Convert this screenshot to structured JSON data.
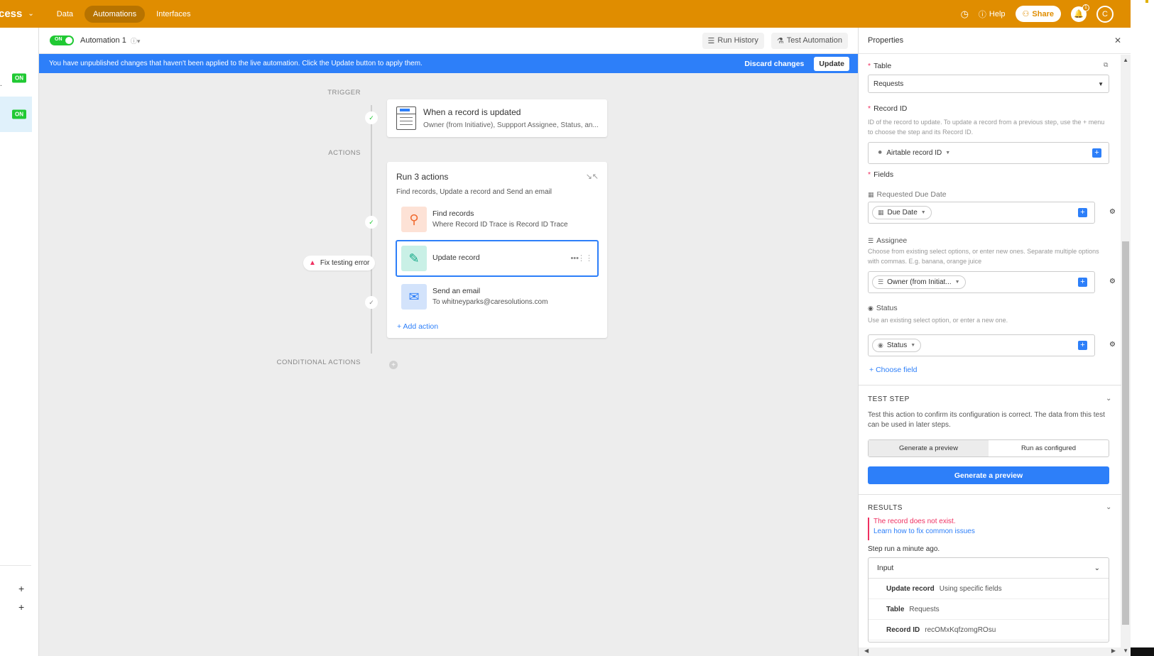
{
  "topbar": {
    "base_name": "cess",
    "nav": [
      "Data",
      "Automations",
      "Interfaces"
    ],
    "help_label": "Help",
    "share_label": "Share",
    "notification_count": "1",
    "avatar_initial": "C"
  },
  "sidebar": {
    "on_label": "ON",
    "dot_text": "."
  },
  "canvas_header": {
    "toggle_label": "ON",
    "automation_name": "Automation 1",
    "run_history_label": "Run History",
    "test_automation_label": "Test Automation"
  },
  "banner": {
    "message": "You have unpublished changes that haven't been applied to the live automation. Click the Update button to apply them.",
    "discard_label": "Discard changes",
    "update_label": "Update"
  },
  "canvas": {
    "trigger_label": "TRIGGER",
    "actions_label": "ACTIONS",
    "conditional_label": "CONDITIONAL ACTIONS",
    "trigger": {
      "title": "When a record is updated",
      "subtitle": "Owner (from Initiative), Suppport Assignee, Status, an..."
    },
    "actions": {
      "title": "Run 3 actions",
      "subtitle": "Find records, Update a record and Send an email",
      "items": [
        {
          "title": "Find records",
          "subtitle": "Where Record ID Trace is Record ID Trace"
        },
        {
          "title": "Update record",
          "subtitle": ""
        },
        {
          "title": "Send an email",
          "subtitle": "To whitneyparks@caresolutions.com"
        }
      ],
      "add_action_label": "Add action"
    },
    "fix_error_label": "Fix testing error"
  },
  "panel": {
    "title": "Properties",
    "table_label": "Table",
    "table_value": "Requests",
    "record_id_label": "Record ID",
    "record_id_help": "ID of the record to update. To update a record from a previous step, use the + menu to choose the step and its Record ID.",
    "record_id_token": "Airtable record ID",
    "fields_label": "Fields",
    "field_due_label": "Requested Due Date",
    "field_due_token": "Due Date",
    "field_assignee_label": "Assignee",
    "field_assignee_help": "Choose from existing select options, or enter new ones. Separate multiple options with commas. E.g. banana, orange juice",
    "field_assignee_token": "Owner (from Initiat...",
    "field_status_label": "Status",
    "field_status_help": "Use an existing select option, or enter a new one.",
    "field_status_token": "Status",
    "choose_field_label": "Choose field",
    "test_step_heading": "TEST STEP",
    "test_step_desc": "Test this action to confirm its configuration is correct. The data from this test can be used in later steps.",
    "seg_preview": "Generate a preview",
    "seg_configured": "Run as configured",
    "generate_button": "Generate a preview",
    "results_heading": "RESULTS",
    "error_msg": "The record does not exist.",
    "error_link": "Learn how to fix common issues",
    "step_run": "Step run a minute ago.",
    "input_heading": "Input",
    "input_rows": [
      {
        "k": "Update record",
        "v": "Using specific fields"
      },
      {
        "k": "Table",
        "v": "Requests"
      },
      {
        "k": "Record ID",
        "v": "recOMxKqfzomgROsu"
      }
    ]
  },
  "colors": {
    "topbar": "#e08d00",
    "banner": "#2d7ff9",
    "accent": "#2d7ff9",
    "on_badge": "#20c933",
    "error": "#ef3061"
  },
  "icons": {
    "history": "history-icon",
    "help": "help-icon",
    "share": "share-icon",
    "bell": "bell-icon",
    "find": "search-icon",
    "update": "pencil-icon",
    "email": "envelope-icon"
  }
}
